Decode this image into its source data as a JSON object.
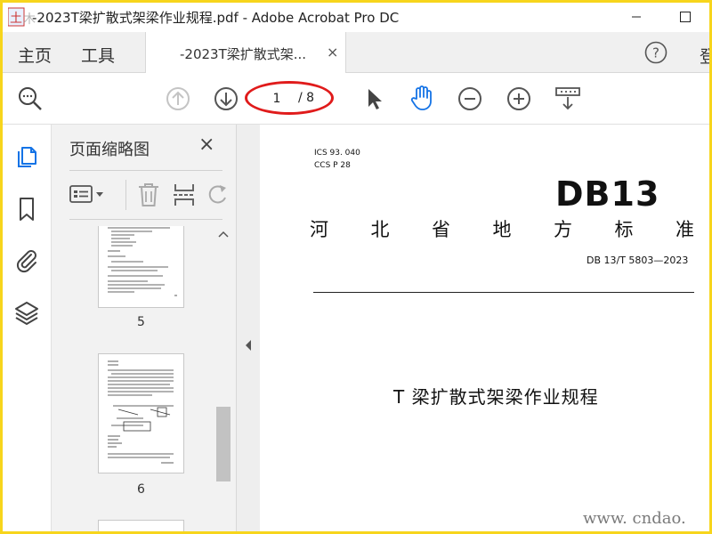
{
  "window": {
    "title": "-2023T梁扩散式架梁作业规程.pdf - Adobe Acrobat Pro DC",
    "logo_text": "土木门"
  },
  "menubar": {
    "home_label": "主页",
    "tools_label": "工具",
    "doc_tab_label": "-2023T梁扩散式架...",
    "doc_tab_close": "×",
    "help_label": "?",
    "signin_label": "登"
  },
  "toolbar": {
    "current_page": "1",
    "page_total": "/ 8"
  },
  "thumbnails_panel": {
    "title": "页面缩略图",
    "close": "×",
    "thumbs": [
      {
        "label": "5"
      },
      {
        "label": "6"
      }
    ]
  },
  "document": {
    "ics": "ICS  93. 040",
    "ccs": "CCS  P  28",
    "code_mark": "DB13",
    "standard_chars": [
      "河",
      "北",
      "省",
      "地",
      "方",
      "标",
      "准"
    ],
    "standard_code": "DB 13/T  5803—2023",
    "title": "T 梁扩散式架梁作业规程"
  },
  "watermark": "www. cndao. com",
  "colors": {
    "border": "#f7d51c",
    "annotation": "#e01b1b",
    "accent_blue": "#1473e6"
  }
}
